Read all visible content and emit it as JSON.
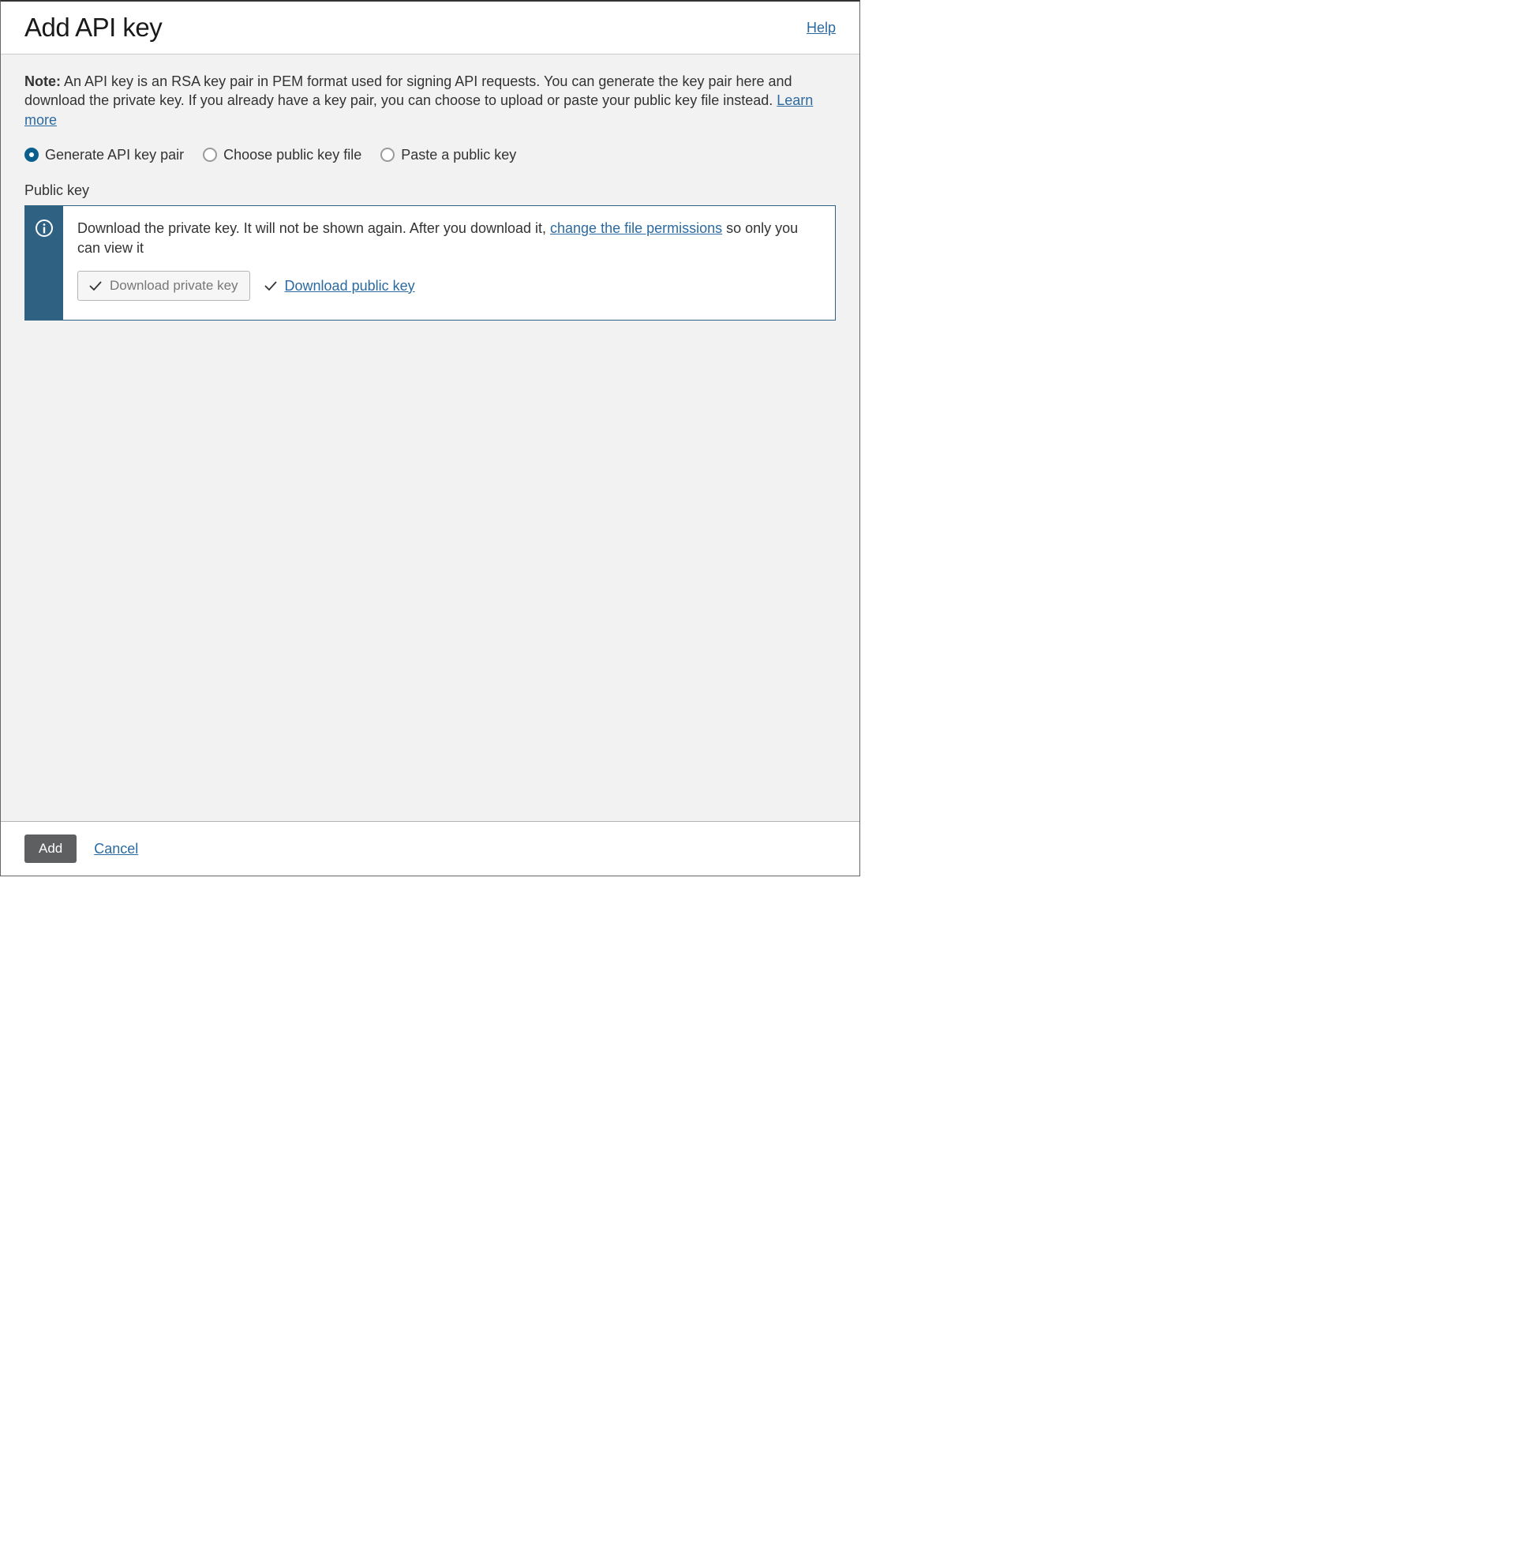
{
  "header": {
    "title": "Add API key",
    "help": "Help"
  },
  "note": {
    "label": "Note:",
    "text": " An API key is an RSA key pair in PEM format used for signing API requests. You can generate the key pair here and download the private key. If you already have a key pair, you can choose to upload or paste your public key file instead. ",
    "learn_more": "Learn more"
  },
  "radios": {
    "generate": "Generate API key pair",
    "choose": "Choose public key file",
    "paste": "Paste a public key"
  },
  "section_label": "Public key",
  "info": {
    "text_before": "Download the private key. It will not be shown again. After you download it, ",
    "link_text": "change the file permissions",
    "text_after": " so only you can view it",
    "download_private": "Download private key",
    "download_public": "Download public key"
  },
  "footer": {
    "add": "Add",
    "cancel": "Cancel"
  }
}
